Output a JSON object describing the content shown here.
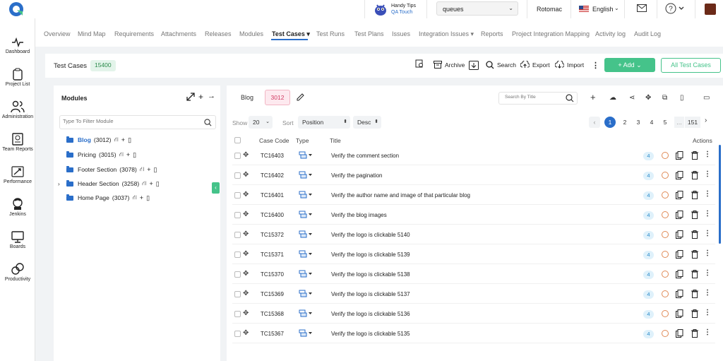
{
  "topbar": {
    "handy_title": "Handy Tips",
    "handy_subtitle": "QA Touch",
    "project_value": "queues",
    "user_name": "Rotomac",
    "language": "English"
  },
  "sidebar": {
    "items": [
      {
        "label": "Dashboard",
        "icon": "pulse-icon"
      },
      {
        "label": "Project List",
        "icon": "clipboard-icon"
      },
      {
        "label": "Administration",
        "icon": "users-icon"
      },
      {
        "label": "Team Reports",
        "icon": "report-icon"
      },
      {
        "label": "Performance",
        "icon": "rocket-icon"
      },
      {
        "label": "Jenkins",
        "icon": "jenkins-icon"
      },
      {
        "label": "Boards",
        "icon": "monitor-icon"
      },
      {
        "label": "Productivity",
        "icon": "productivity-icon"
      }
    ]
  },
  "nav": {
    "tabs": [
      {
        "label": "Overview"
      },
      {
        "label": "Mind Map"
      },
      {
        "label": "Requirements"
      },
      {
        "label": "Attachments"
      },
      {
        "label": "Releases"
      },
      {
        "label": "Modules"
      },
      {
        "label": "Test Cases ▾"
      },
      {
        "label": "Test Runs"
      },
      {
        "label": "Test Plans"
      },
      {
        "label": "Issues"
      },
      {
        "label": "Integration Issues ▾"
      },
      {
        "label": "Reports"
      },
      {
        "label": "Project Integration Mapping"
      },
      {
        "label": "Activity log"
      },
      {
        "label": "Audit Log"
      }
    ]
  },
  "header": {
    "title": "Test Cases",
    "count": "15400",
    "guide_label": "Guide",
    "archive_label": "Archive",
    "search_label": "Search",
    "export_label": "Export",
    "import_label": "Import",
    "add_label": "+ Add",
    "all_label": "All Test Cases"
  },
  "modules": {
    "title": "Modules",
    "filter_placeholder": "Type To Filter Module",
    "items": [
      {
        "name": "Blog",
        "count": "(3012)",
        "selected": true
      },
      {
        "name": "Pricing",
        "count": "(3015)"
      },
      {
        "name": "Footer Section",
        "count": "(3078)"
      },
      {
        "name": "Header Section",
        "count": "(3258)",
        "expandable": true
      },
      {
        "name": "Home Page",
        "count": "(3037)"
      }
    ]
  },
  "testcases": {
    "module_name": "Blog",
    "module_count": "3012",
    "search_placeholder": "Search By Title",
    "show_label": "Show",
    "page_size": "20",
    "sort_label": "Sort",
    "sort_value": "Position",
    "sort_dir": "Desc",
    "pagination": {
      "pages": [
        "1",
        "2",
        "3",
        "4",
        "5"
      ],
      "dots": "...",
      "last": "151"
    },
    "columns": {
      "code": "Case Code",
      "type": "Type",
      "title": "Title",
      "actions": "Actions"
    },
    "rows": [
      {
        "code": "TC16403",
        "title": "Verify the comment section",
        "priority": "4"
      },
      {
        "code": "TC16402",
        "title": "Verify the pagination",
        "priority": "4"
      },
      {
        "code": "TC16401",
        "title": "Verify the author name and image of that particular blog",
        "priority": "4"
      },
      {
        "code": "TC16400",
        "title": "Verify the blog images",
        "priority": "4"
      },
      {
        "code": "TC15372",
        "title": "Verify the logo is clickable 5140",
        "priority": "4"
      },
      {
        "code": "TC15371",
        "title": "Verify the logo is clickable 5139",
        "priority": "4"
      },
      {
        "code": "TC15370",
        "title": "Verify the logo is clickable 5138",
        "priority": "4"
      },
      {
        "code": "TC15369",
        "title": "Verify the logo is clickable 5137",
        "priority": "4"
      },
      {
        "code": "TC15368",
        "title": "Verify the logo is clickable 5136",
        "priority": "4"
      },
      {
        "code": "TC15367",
        "title": "Verify the logo is clickable 5135",
        "priority": "4"
      }
    ]
  },
  "colors": {
    "accent": "#2a6ec9",
    "add_green": "#45c38a",
    "count_pink": "#d23a62"
  }
}
